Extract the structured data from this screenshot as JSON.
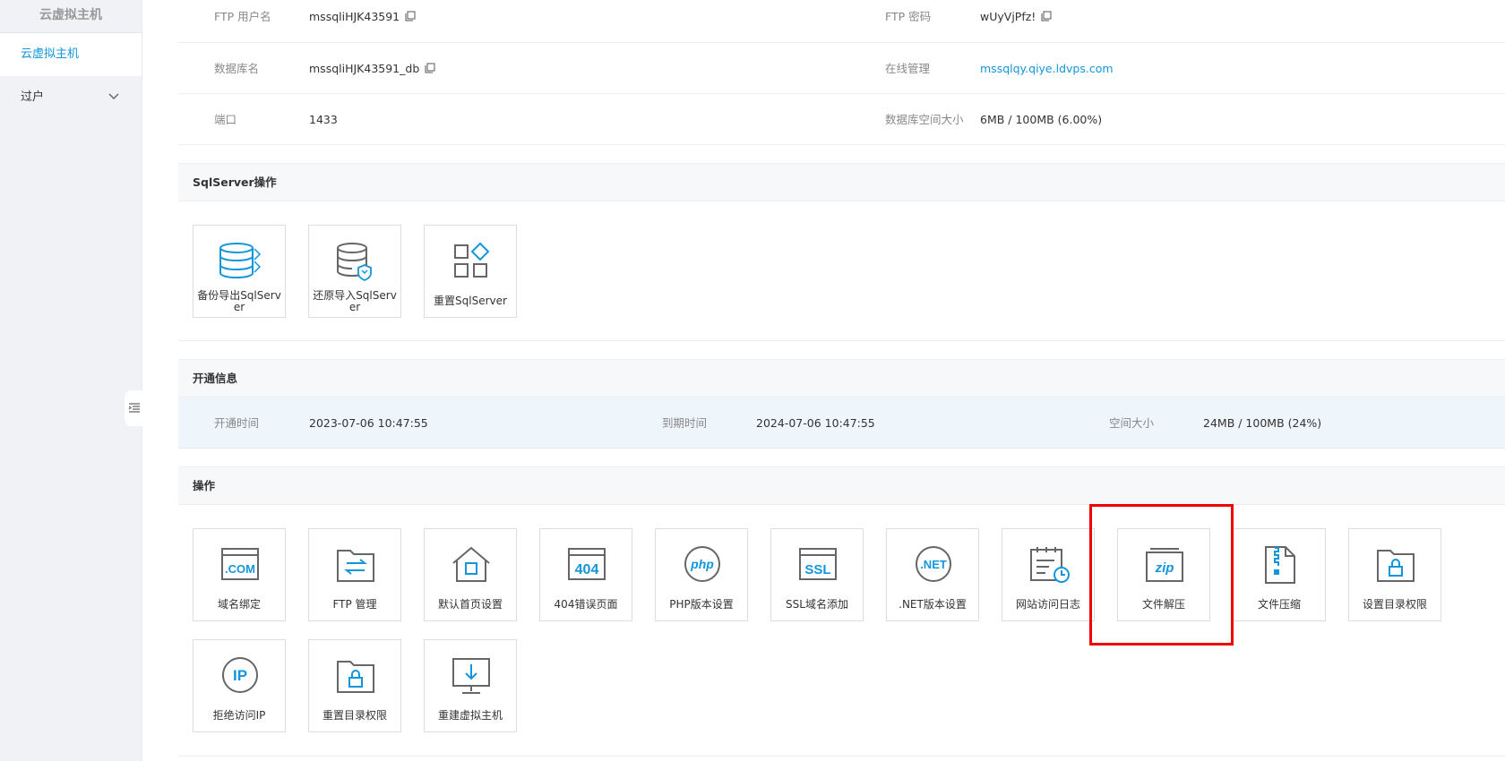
{
  "sidebar": {
    "header": "云虚拟主机",
    "items": [
      {
        "label": "云虚拟主机"
      },
      {
        "label": "过户"
      }
    ],
    "expand_glyph": "⌄",
    "collapse_glyph": "☰"
  },
  "info": {
    "ftp_user_label": "FTP 用户名",
    "ftp_user_value": "mssqliHJK43591",
    "ftp_pwd_label": "FTP 密码",
    "ftp_pwd_value": "wUyVjPfz!",
    "db_name_label": "数据库名",
    "db_name_value": "mssqliHJK43591_db",
    "online_mgmt_label": "在线管理",
    "online_mgmt_value": "mssqlqy.qiye.ldvps.com",
    "port_label": "端口",
    "port_value": "1433",
    "db_space_label": "数据库空间大小",
    "db_space_value": "6MB / 100MB (6.00%)"
  },
  "sqlserver": {
    "title": "SqlServer操作",
    "tiles": [
      {
        "label": "备份导出SqlServer",
        "icon": "database-export-icon"
      },
      {
        "label": "还原导入SqlServer",
        "icon": "database-restore-icon"
      },
      {
        "label": "重置SqlServer",
        "icon": "reset-grid-icon"
      }
    ]
  },
  "open_info": {
    "title": "开通信息",
    "open_time_label": "开通时间",
    "open_time_value": "2023-07-06 10:47:55",
    "expire_label": "到期时间",
    "expire_value": "2024-07-06 10:47:55",
    "space_label": "空间大小",
    "space_value": "24MB / 100MB (24%)"
  },
  "operations": {
    "title": "操作",
    "tiles": [
      {
        "label": "域名绑定",
        "icon": "com-domain-icon",
        "glyph": ".COM"
      },
      {
        "label": "FTP 管理",
        "icon": "ftp-folder-icon"
      },
      {
        "label": "默认首页设置",
        "icon": "home-icon"
      },
      {
        "label": "404错误页面",
        "icon": "error-404-icon",
        "glyph": "404"
      },
      {
        "label": "PHP版本设置",
        "icon": "php-icon",
        "glyph": "php"
      },
      {
        "label": "SSL域名添加",
        "icon": "ssl-icon",
        "glyph": "SSL"
      },
      {
        "label": ".NET版本设置",
        "icon": "dotnet-icon",
        "glyph": ".NET"
      },
      {
        "label": "网站访问日志",
        "icon": "access-log-icon"
      },
      {
        "label": "文件解压",
        "icon": "zip-extract-icon",
        "glyph": "zip"
      },
      {
        "label": "文件压缩",
        "icon": "file-compress-icon"
      },
      {
        "label": "设置目录权限",
        "icon": "folder-lock-icon"
      },
      {
        "label": "拒绝访问IP",
        "icon": "ip-deny-icon",
        "glyph": "IP"
      },
      {
        "label": "重置目录权限",
        "icon": "folder-reset-lock-icon"
      },
      {
        "label": "重建虚拟主机",
        "icon": "rebuild-host-icon"
      }
    ]
  },
  "colors": {
    "accent": "#1296db",
    "highlight": "#e00000"
  }
}
